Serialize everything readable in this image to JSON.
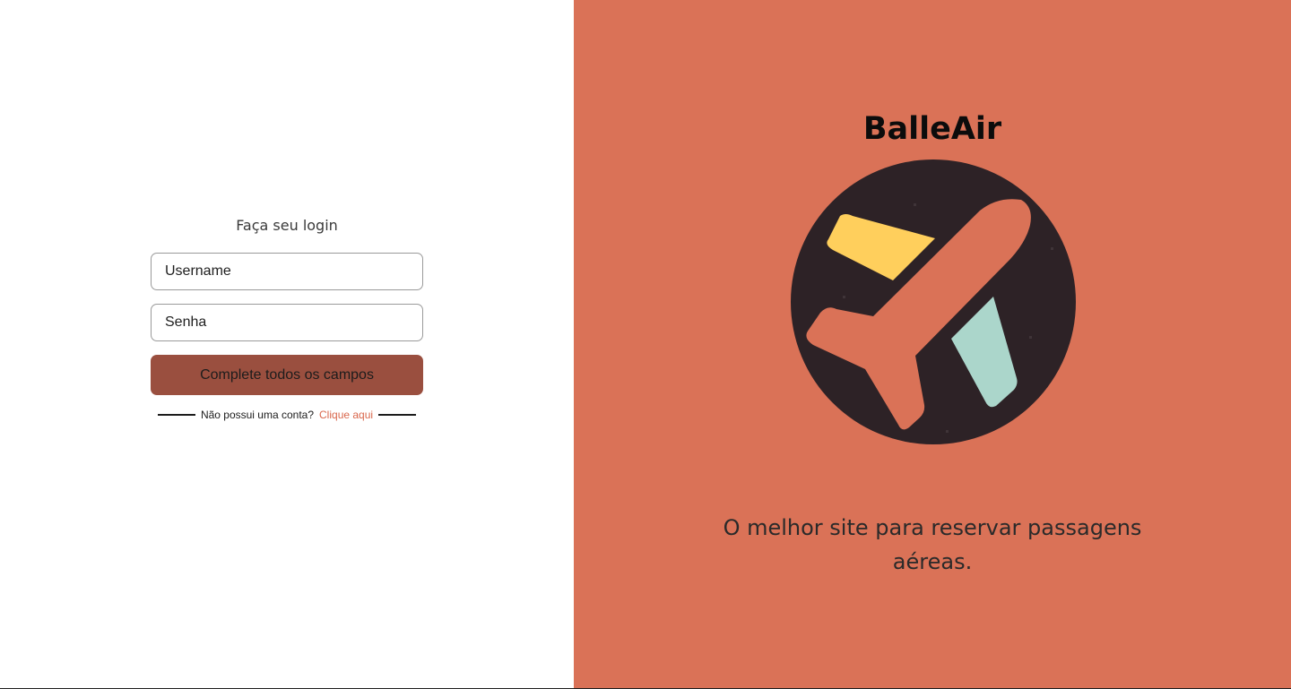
{
  "login": {
    "title": "Faça seu login",
    "username_placeholder": "Username",
    "password_placeholder": "Senha",
    "submit_label": "Complete todos os campos",
    "signup_prompt": "Não possui uma conta?",
    "signup_link": "Clique aqui"
  },
  "hero": {
    "brand": "BalleAir",
    "tagline": "O melhor site para reservar passagens aéreas.",
    "logo_icon": "airplane-icon"
  },
  "colors": {
    "panel_bg": "#DA7257",
    "button_bg": "#9A4F3F",
    "link": "#D9674C",
    "logo_circle": "#2D2226",
    "plane": "#DA7257",
    "wing_yellow": "#FFCF5C",
    "wing_mint": "#ABD6CB"
  }
}
